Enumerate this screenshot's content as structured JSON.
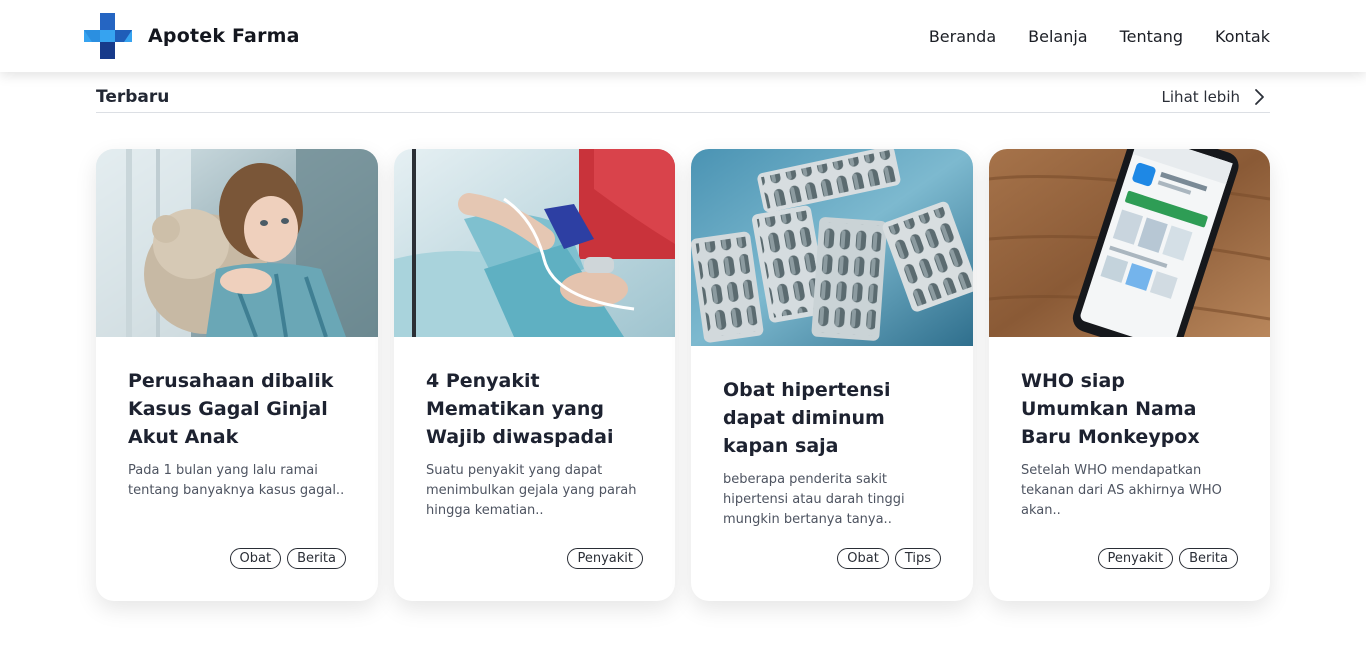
{
  "brand": {
    "name": "Apotek Farma",
    "logo_icon": "medical-cross-icon",
    "colors": {
      "logo_light": "#36a3f0",
      "logo_dark": "#173a8a"
    }
  },
  "nav": {
    "items": [
      {
        "label": "Beranda"
      },
      {
        "label": "Belanja"
      },
      {
        "label": "Tentang"
      },
      {
        "label": "Kontak"
      }
    ]
  },
  "section": {
    "title": "Terbaru",
    "see_more_label": "Lihat lebih",
    "see_more_icon": "chevron-right-icon"
  },
  "cards": [
    {
      "image": "child-hugging-teddy-bear-photo",
      "title": "Perusahaan dibalik Kasus Gagal Ginjal Akut Anak",
      "excerpt": "Pada 1 bulan yang lalu ramai tentang banyaknya kasus gagal..",
      "tags": [
        "Obat",
        "Berita"
      ]
    },
    {
      "image": "hospital-patient-iv-drip-photo",
      "title": "4 Penyakit Mematikan yang Wajib diwaspadai",
      "excerpt": "Suatu penyakit yang dapat menimbulkan gejala yang parah hingga kematian..",
      "tags": [
        "Penyakit"
      ]
    },
    {
      "image": "pill-blister-packs-photo",
      "title": "Obat hipertensi dapat diminum kapan saja",
      "excerpt": "beberapa penderita sakit hipertensi atau darah tinggi mungkin bertanya tanya..",
      "tags": [
        "Obat",
        "Tips"
      ]
    },
    {
      "image": "smartphone-who-app-photo",
      "title": "WHO siap Umumkan Nama Baru Monkeypox",
      "excerpt": "Setelah WHO mendapatkan tekanan dari AS akhirnya WHO akan..",
      "tags": [
        "Penyakit",
        "Berita"
      ]
    }
  ]
}
